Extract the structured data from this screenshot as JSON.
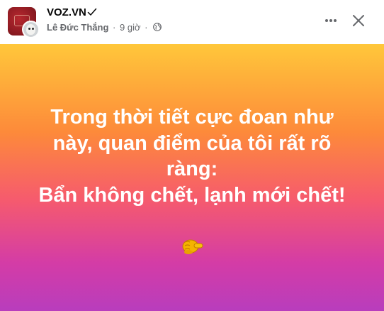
{
  "post": {
    "page_name": "VOZ.VN",
    "author": "Lê Đức Thắng",
    "separator": "·",
    "time": "9 giờ",
    "audience_icon": "globe-icon",
    "verified_icon": "checkmark-icon",
    "lines": [
      "Trong thời tiết cực đoan như",
      "này, quan điểm của tôi rất rõ",
      "ràng:",
      "Bẩn không chết, lạnh mới chết!"
    ],
    "emoji_icon": "pointing-hand-icon"
  },
  "actions": {
    "more_icon": "more-horizontal-icon",
    "close_icon": "close-icon"
  },
  "colors": {
    "gradient_top": "#ffc73a",
    "gradient_mid": "#f65b6d",
    "gradient_bottom": "#b83dbd",
    "text": "#ffffff",
    "meta_text": "#65676b"
  }
}
